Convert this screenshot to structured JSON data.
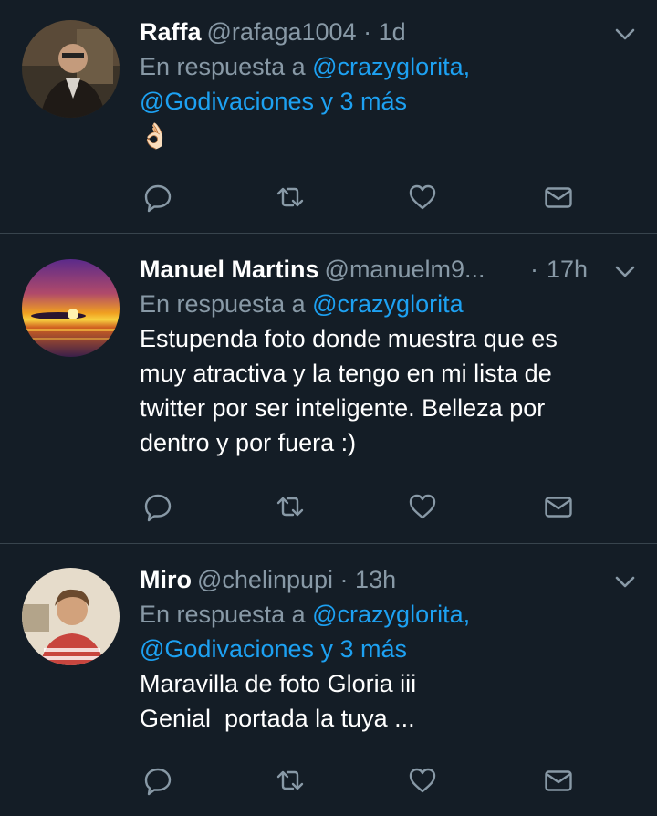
{
  "tweets": [
    {
      "name": "Raffa",
      "handle": "@rafaga1004",
      "dot": "·",
      "time": "1d",
      "reply_prefix": "En respuesta a",
      "reply_mentions_line1": "@crazyglorita,",
      "reply_mentions_line2": "@Godivaciones y 3 más",
      "text_lines": [
        "👌🏻"
      ]
    },
    {
      "name": "Manuel Martins",
      "handle": "@manuelm9...",
      "dot": "·",
      "time": "17h",
      "reply_prefix": "En respuesta a",
      "reply_mentions_line1": "@crazyglorita",
      "text_lines": [
        "Estupenda foto donde muestra que es",
        "muy atractiva y la tengo en mi lista de",
        "twitter por ser inteligente. Belleza por",
        "dentro y por fuera :)"
      ]
    },
    {
      "name": "Miro",
      "handle": "@chelinpupi",
      "dot": "·",
      "time": "13h",
      "reply_prefix": "En respuesta a",
      "reply_mentions_line1": "@crazyglorita,",
      "reply_mentions_line2": "@Godivaciones y 3 más",
      "text_lines": [
        "Maravilla de foto Gloria iii",
        "Genial  portada la tuya ..."
      ]
    }
  ],
  "icons": {
    "reply": "reply-icon",
    "retweet": "retweet-icon",
    "like": "heart-icon",
    "message": "envelope-icon",
    "menu": "chevron-down-icon"
  },
  "colors": {
    "background": "#141d26",
    "divider": "#38444d",
    "secondary_text": "#8899a6",
    "link": "#1da1f2",
    "primary_text": "#ffffff"
  }
}
